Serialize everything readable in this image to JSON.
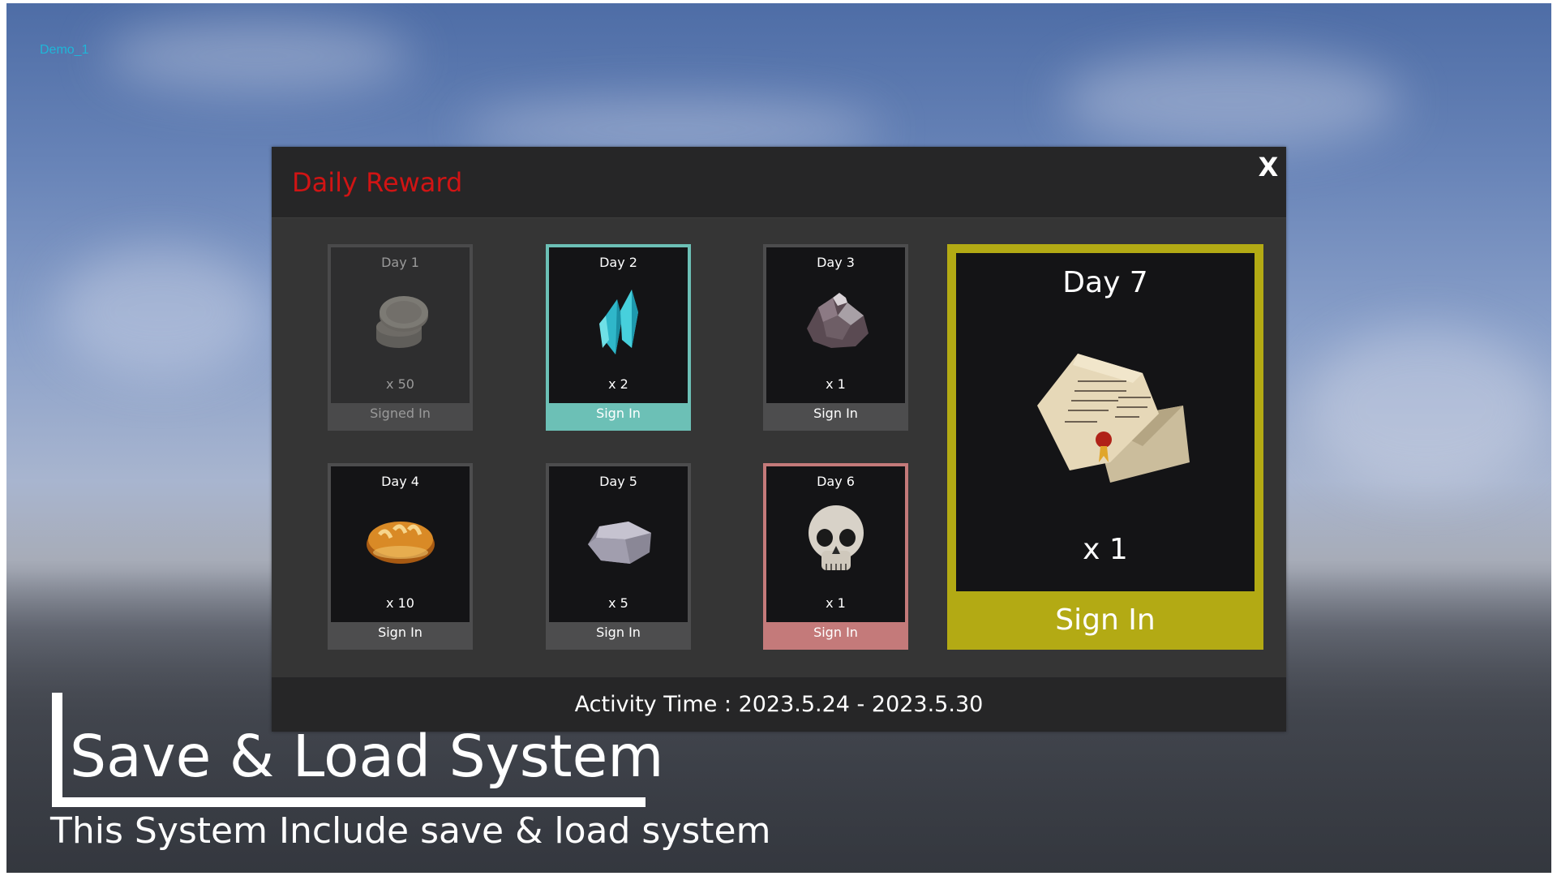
{
  "demo_label": "Demo_1",
  "panel": {
    "title": "Daily Reward",
    "close_label": "X",
    "activity_time": "Activity Time : 2023.5.24 - 2023.5.30"
  },
  "cards": [
    {
      "day": "Day 1",
      "icon": "coins-icon",
      "quantity": "x 50",
      "button": "Signed In",
      "state": "signed"
    },
    {
      "day": "Day 2",
      "icon": "crystal-icon",
      "quantity": "x 2",
      "button": "Sign In",
      "state": "active-teal"
    },
    {
      "day": "Day 3",
      "icon": "ore-icon",
      "quantity": "x 1",
      "button": "Sign In",
      "state": "default"
    },
    {
      "day": "Day 4",
      "icon": "bread-icon",
      "quantity": "x 10",
      "button": "Sign In",
      "state": "default"
    },
    {
      "day": "Day 5",
      "icon": "stone-icon",
      "quantity": "x 5",
      "button": "Sign In",
      "state": "default"
    },
    {
      "day": "Day 6",
      "icon": "skull-icon",
      "quantity": "x 1",
      "button": "Sign In",
      "state": "active-red"
    }
  ],
  "grand_card": {
    "day": "Day 7",
    "icon": "letter-scroll-icon",
    "quantity": "x 1",
    "button": "Sign In"
  },
  "overlay": {
    "title": "Save & Load System",
    "subtitle": "This System Include save & load system"
  },
  "colors": {
    "title_red": "#d01414",
    "teal": "#6cc0b6",
    "rose": "#c47a7a",
    "gold": "#b3aa14"
  }
}
